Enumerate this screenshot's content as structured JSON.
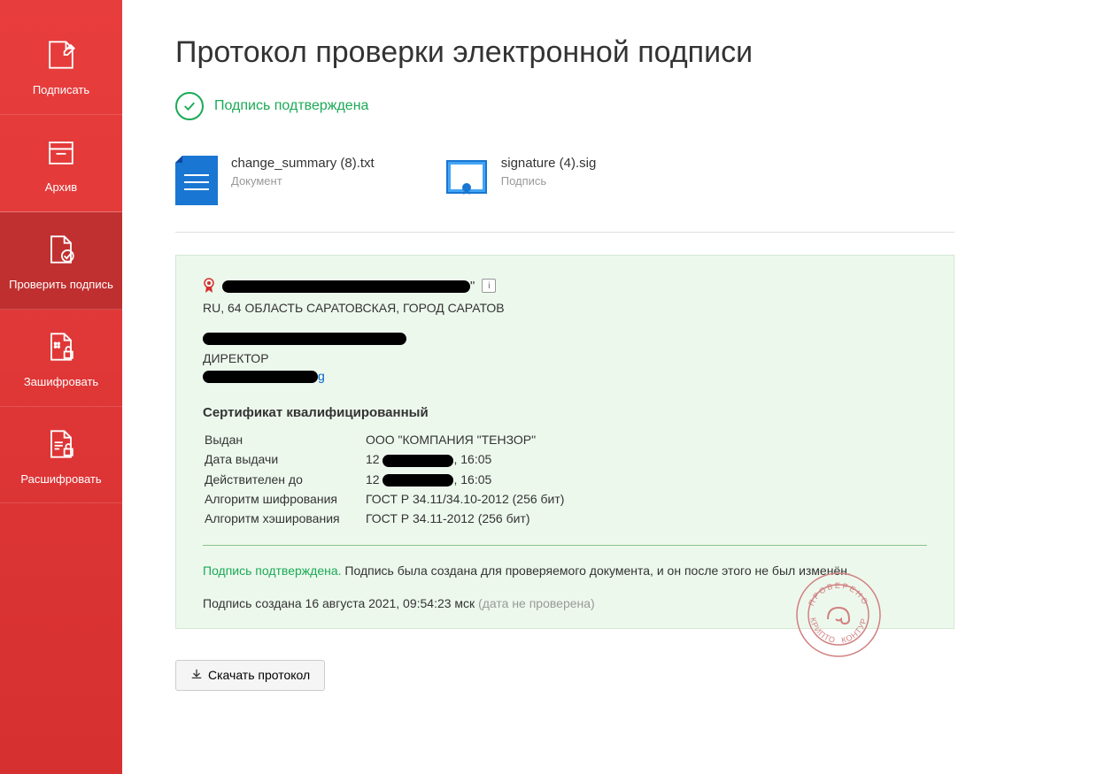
{
  "sidebar": {
    "items": [
      {
        "label": "Подписать"
      },
      {
        "label": "Архив"
      },
      {
        "label": "Проверить подпись"
      },
      {
        "label": "Зашифровать"
      },
      {
        "label": "Расшифровать"
      }
    ]
  },
  "main": {
    "title": "Протокол проверки электронной подписи",
    "status": "Подпись подтверждена",
    "files": [
      {
        "name": "change_summary (8).txt",
        "type": "Документ"
      },
      {
        "name": "signature (4).sig",
        "type": "Подпись"
      }
    ]
  },
  "cert": {
    "org_quote_suffix": "\"",
    "info_symbol": "i",
    "addr": "RU, 64 ОБЛАСТЬ САРАТОВСКАЯ, ГОРОД САРАТОВ",
    "position": "ДИРЕКТОР",
    "email_suffix": "g",
    "title": "Сертификат квалифицированный",
    "rows": {
      "issued_label": "Выдан",
      "issued_value": "ООО \"КОМПАНИЯ \"ТЕНЗОР\"",
      "date_label": "Дата выдачи",
      "date_prefix": "12 ",
      "date_suffix": ", 16:05",
      "valid_label": "Действителен до",
      "valid_prefix": "12 ",
      "valid_suffix": ", 16:05",
      "enc_label": "Алгоритм шифрования",
      "enc_value": "ГОСТ Р 34.11/34.10-2012 (256 бит)",
      "hash_label": "Алгоритм хэширования",
      "hash_value": "ГОСТ Р 34.11-2012 (256 бит)"
    },
    "confirm_label": "Подпись подтверждена.",
    "confirm_text": " Подпись была создана для проверяемого документа, и он после этого не был изменён.",
    "created": "Подпись создана 16 августа 2021, 09:54:23 мск ",
    "created_note": "(дата не проверена)"
  },
  "stamp": {
    "top": "ПРОВЕРЕНО",
    "right": "КОНТУР",
    "bottom": "КРИПТО"
  },
  "download": {
    "label": "Скачать протокол"
  }
}
